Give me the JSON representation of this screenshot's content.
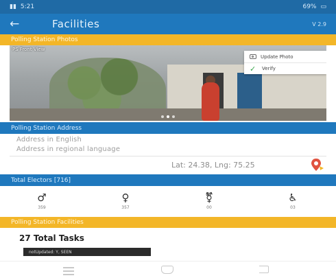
{
  "status_bar": {
    "left_text": "5:21",
    "right_text": "69%"
  },
  "app_bar": {
    "back_icon": "arrow-left-icon",
    "title": "Facilities",
    "version": "V 2.9"
  },
  "sections": {
    "photos": "Polling Station Photos",
    "address": "Polling Station Address",
    "electors": "Total Electors [716]",
    "facilities": "Polling Station Facilities"
  },
  "photo": {
    "caption": "PS Front View",
    "menu": {
      "update_photo": "Update Photo",
      "verify": "Verify"
    },
    "page_count": 3,
    "active_page": 1
  },
  "address": {
    "english": "Address in English",
    "regional": "Address in regional language",
    "latlng": "Lat: 24.38, Lng: 75.25"
  },
  "electors": [
    {
      "icon": "male-icon",
      "count": "359"
    },
    {
      "icon": "female-icon",
      "count": "357"
    },
    {
      "icon": "third-gender-icon",
      "count": "00"
    },
    {
      "icon": "wheelchair-icon",
      "count": "03"
    }
  ],
  "facilities": {
    "total_tasks": "27 Total Tasks",
    "tag": "notUpdated: Y, SEEN"
  },
  "colors": {
    "primary": "#1f78bd",
    "accent": "#f3b628",
    "verify": "#3aa64b",
    "pin": "#e0523f"
  }
}
